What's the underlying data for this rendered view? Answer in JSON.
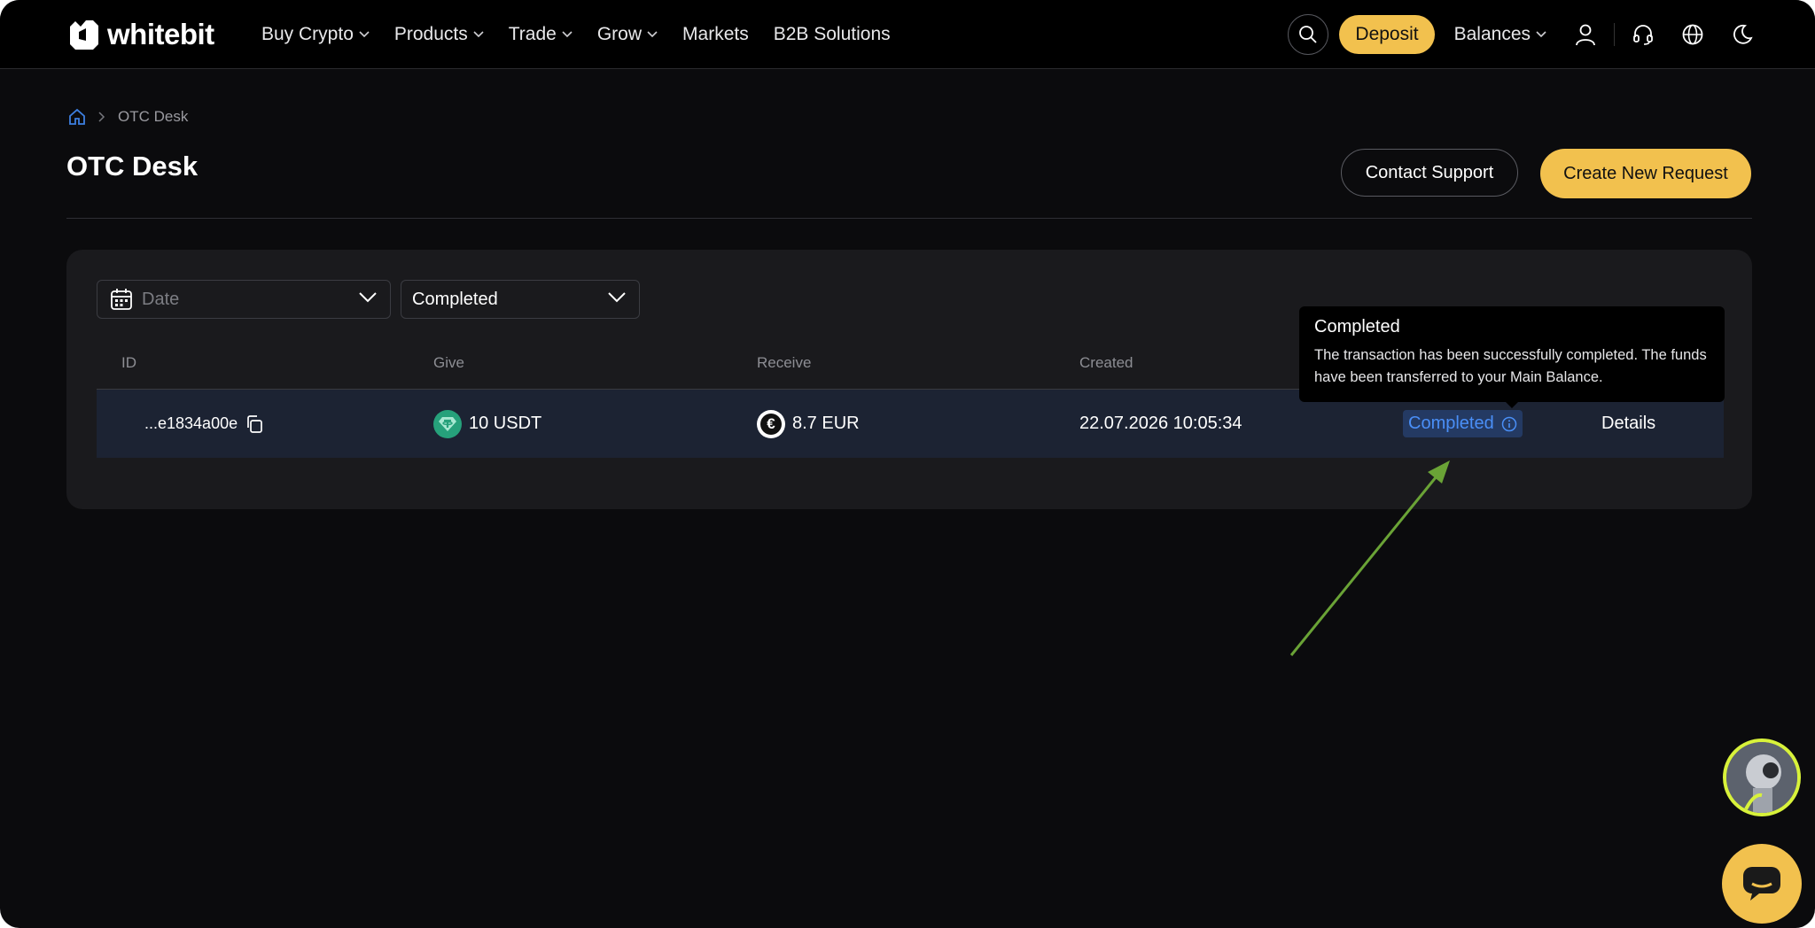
{
  "brand": {
    "name": "whitebit"
  },
  "nav": {
    "items": [
      {
        "label": "Buy Crypto",
        "dropdown": true
      },
      {
        "label": "Products",
        "dropdown": true
      },
      {
        "label": "Trade",
        "dropdown": true
      },
      {
        "label": "Grow",
        "dropdown": true
      },
      {
        "label": "Markets",
        "dropdown": false
      },
      {
        "label": "B2B Solutions",
        "dropdown": false
      }
    ],
    "deposit_label": "Deposit",
    "balances_label": "Balances",
    "icons": [
      "search-icon",
      "user-icon",
      "headset-icon",
      "globe-icon",
      "moon-icon"
    ]
  },
  "breadcrumb": {
    "current": "OTC Desk"
  },
  "page": {
    "title": "OTC Desk",
    "contact_support_label": "Contact Support",
    "create_request_label": "Create New Request"
  },
  "filters": {
    "date_placeholder": "Date",
    "status_value": "Completed"
  },
  "table": {
    "columns": {
      "id": "ID",
      "give": "Give",
      "receive": "Receive",
      "created": "Created"
    },
    "rows": [
      {
        "id": "...e1834a00e",
        "give": "10 USDT",
        "receive": "8.7 EUR",
        "created": "22.07.2026 10:05:34",
        "status": "Completed",
        "action": "Details"
      }
    ]
  },
  "tooltip": {
    "title": "Completed",
    "body": "The transaction has been successfully completed. The funds have been transferred to your Main Balance."
  },
  "colors": {
    "accent_yellow": "#f2c14e",
    "status_blue": "#4a8ff7",
    "annotation_green": "#6aa336",
    "background": "#0b0b0d"
  }
}
